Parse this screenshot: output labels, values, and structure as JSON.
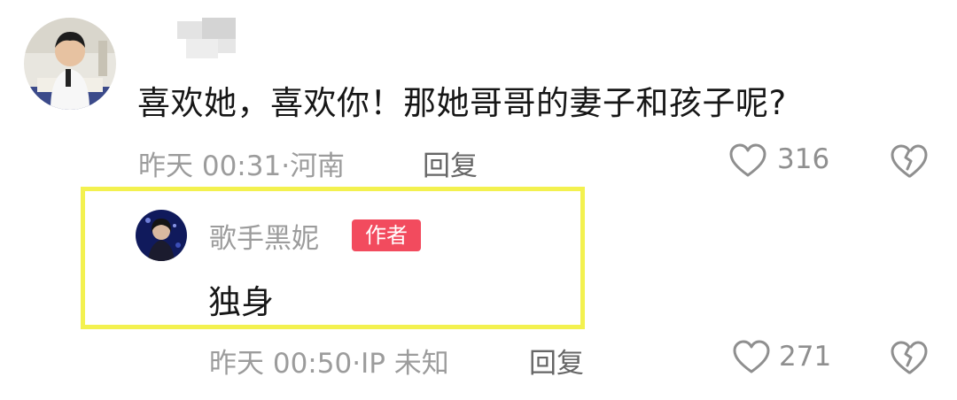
{
  "comment": {
    "text": "喜欢她，喜欢你！那她哥哥的妻子和孩子呢?",
    "time": "昨天 00:31",
    "location": "河南",
    "reply_label": "回复",
    "likes": "316"
  },
  "reply": {
    "author": "歌手黑妮",
    "badge": "作者",
    "text": "独身",
    "time": "昨天 00:50",
    "location": "IP 未知",
    "reply_label": "回复",
    "likes": "271"
  },
  "colors": {
    "highlight": "#f3f14f",
    "badge": "#f24b5e",
    "meta_text": "#9c9c9c"
  },
  "icons": [
    "heart-outline-icon",
    "broken-heart-icon"
  ]
}
